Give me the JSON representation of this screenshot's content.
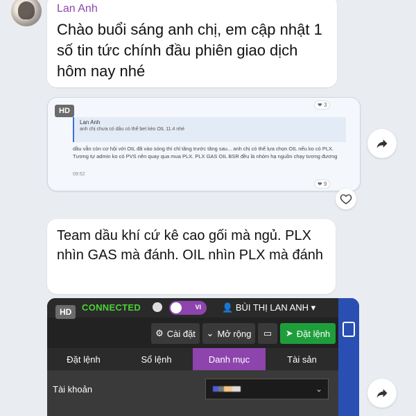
{
  "chat": {
    "msg1": {
      "sender": "Lan Anh",
      "text": "Chào buổi sáng anh chị, em cập nhật 1 số tin tức chính đầu phiên giao dịch hôm nay nhé"
    },
    "msg2": {
      "badge": "HD",
      "reaction_top": "3",
      "quote_name": "Lan Anh",
      "quote_text": "anh chị chưa có dầu có thể bet kèo OIL 11.4 nhé",
      "body": "dầu vẫn còn cơ hội với OIL đã vào sóng thì chỉ tăng trước tăng sau... anh chị có thể lựa chọn OIL nếu ko có PLX. Tương tự admin ko có PVS nên quay qua mua PLX. PLX GAS OIL BSR đều là nhóm hạ nguồn chạy tương đương",
      "time": "09:52",
      "reaction_bottom": "9"
    },
    "msg3": {
      "text": "Team dầu khí cứ kê cao gối mà ngủ. PLX nhìn GAS mà đánh. OIL nhìn PLX mà đánh"
    }
  },
  "trade_panel": {
    "badge": "HD",
    "status": "CONNECTED",
    "lang": "VI",
    "user": "BÙI THỊ LAN ANH",
    "toolbar": {
      "settings": "Cài đặt",
      "expand": "Mở rộng",
      "order": "Đặt lệnh"
    },
    "tabs": [
      "Đặt lệnh",
      "Sổ lệnh",
      "Danh mục",
      "Tài sản"
    ],
    "active_tab": "Danh mục",
    "account_label": "Tài khoản"
  }
}
